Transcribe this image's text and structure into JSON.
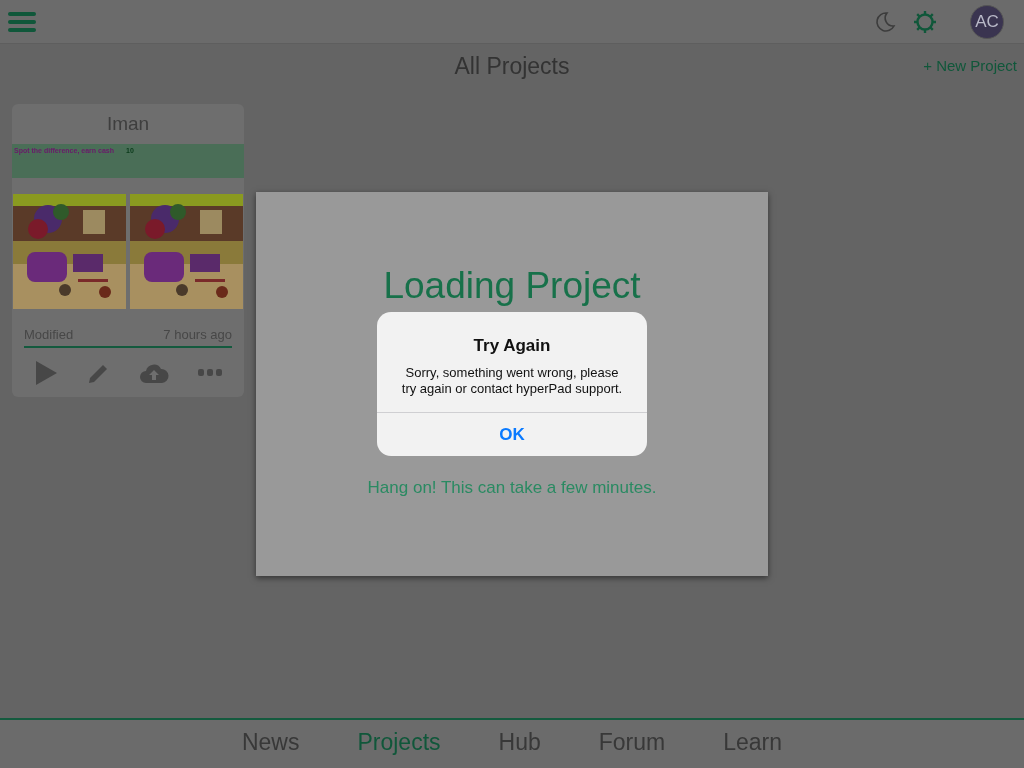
{
  "top_bar": {
    "avatar": "AC"
  },
  "page_title": "All Projects",
  "new_project": "+ New Project",
  "projects": [
    {
      "name": "Iman",
      "thumbnail": {
        "banner": "Spot the difference, earn cash",
        "score": "10"
      },
      "modified_label": "Modified",
      "modified": "7 hours ago"
    }
  ],
  "loading": {
    "title": "Loading Project",
    "hint": "Hang on! This can take a few minutes."
  },
  "alert": {
    "title": "Try Again",
    "message": "Sorry, something went wrong, please try again or contact hyperPad support.",
    "button": "OK"
  },
  "tabs": [
    {
      "label": "News",
      "selected": false
    },
    {
      "label": "Projects",
      "selected": true
    },
    {
      "label": "Hub",
      "selected": false
    },
    {
      "label": "Forum",
      "selected": false
    },
    {
      "label": "Learn",
      "selected": false
    }
  ]
}
